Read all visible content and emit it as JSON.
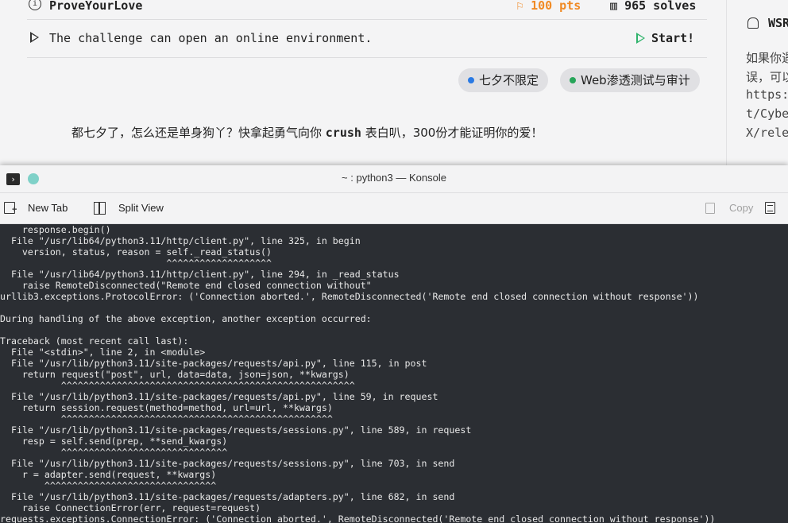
{
  "challenge": {
    "name": "ProveYourLove",
    "points": "100 pts",
    "solves": "965 solves",
    "env_text": "The challenge can open an online environment.",
    "start_label": "Start!",
    "tags": [
      {
        "label": "七夕不限定",
        "color": "#2a7ae4"
      },
      {
        "label": "Web渗透测试与审计",
        "color": "#27a55a"
      }
    ],
    "description_before": "都七夕了，怎么还是单身狗丫？快拿起勇气向你 ",
    "description_bold": "crush",
    "description_after": " 表白叭，300份才能证明你的爱！"
  },
  "sidebar": {
    "title": "WSR",
    "lines": [
      "如果你遇",
      "误，可以",
      "https:/",
      "t/Cybe",
      "X/rele"
    ]
  },
  "konsole": {
    "window_title": "~ : python3 — Konsole",
    "toolbar": {
      "new_tab": "New Tab",
      "split_view": "Split View",
      "copy": "Copy"
    },
    "terminal_lines": [
      "    response.begin()",
      "  File \"/usr/lib64/python3.11/http/client.py\", line 325, in begin",
      "    version, status, reason = self._read_status()",
      "                              ^^^^^^^^^^^^^^^^^^^",
      "  File \"/usr/lib64/python3.11/http/client.py\", line 294, in _read_status",
      "    raise RemoteDisconnected(\"Remote end closed connection without\"",
      "urllib3.exceptions.ProtocolError: ('Connection aborted.', RemoteDisconnected('Remote end closed connection without response'))",
      "",
      "During handling of the above exception, another exception occurred:",
      "",
      "Traceback (most recent call last):",
      "  File \"<stdin>\", line 2, in <module>",
      "  File \"/usr/lib/python3.11/site-packages/requests/api.py\", line 115, in post",
      "    return request(\"post\", url, data=data, json=json, **kwargs)",
      "           ^^^^^^^^^^^^^^^^^^^^^^^^^^^^^^^^^^^^^^^^^^^^^^^^^^^^^",
      "  File \"/usr/lib/python3.11/site-packages/requests/api.py\", line 59, in request",
      "    return session.request(method=method, url=url, **kwargs)",
      "           ^^^^^^^^^^^^^^^^^^^^^^^^^^^^^^^^^^^^^^^^^^^^^^^^^",
      "  File \"/usr/lib/python3.11/site-packages/requests/sessions.py\", line 589, in request",
      "    resp = self.send(prep, **send_kwargs)",
      "           ^^^^^^^^^^^^^^^^^^^^^^^^^^^^^^",
      "  File \"/usr/lib/python3.11/site-packages/requests/sessions.py\", line 703, in send",
      "    r = adapter.send(request, **kwargs)",
      "        ^^^^^^^^^^^^^^^^^^^^^^^^^^^^^^^",
      "  File \"/usr/lib/python3.11/site-packages/requests/adapters.py\", line 682, in send",
      "    raise ConnectionError(err, request=request)",
      "requests.exceptions.ConnectionError: ('Connection aborted.', RemoteDisconnected('Remote end closed connection without response'))"
    ]
  }
}
